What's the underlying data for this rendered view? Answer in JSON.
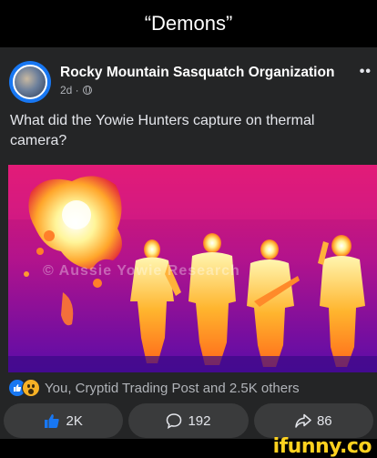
{
  "caption": "“Demons”",
  "post": {
    "author": "Rocky Mountain Sasquatch Organization",
    "time": "2d ·",
    "more": "••",
    "text": "What did the Yowie Hunters capture on thermal camera?"
  },
  "reactions": {
    "summary": "You, Cryptid Trading Post and 2.5K others"
  },
  "actions": {
    "like_count": "2K",
    "comment_count": "192",
    "share_count": "86"
  },
  "watermark": {
    "thermal_text": "© Aussie Yowie Research",
    "brand": "ifunny.co"
  },
  "colors": {
    "facebook_blue": "#1877f2",
    "post_bg": "#242526",
    "button_bg": "#3a3b3c",
    "brand_yellow": "#ffd21f"
  }
}
